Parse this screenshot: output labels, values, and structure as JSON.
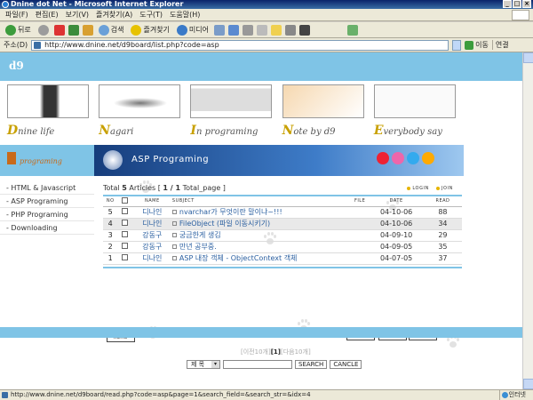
{
  "window": {
    "title": "Dnine dot Net - Microsoft Internet Explorer"
  },
  "menu": [
    "파일(F)",
    "편집(E)",
    "보기(V)",
    "즐겨찾기(A)",
    "도구(T)",
    "도움말(H)"
  ],
  "toolbar": {
    "back": "뒤로",
    "search": "검색",
    "favorites": "즐겨찾기",
    "media": "미디어"
  },
  "address": {
    "label": "주소(D)",
    "url": "http://www.dnine.net/d9board/list.php?code=asp",
    "go": "이동",
    "links": "연결"
  },
  "site": {
    "logo": "d9",
    "nav": [
      {
        "cap": "D",
        "rest": "nine life"
      },
      {
        "cap": "N",
        "rest": "agari"
      },
      {
        "cap": "I",
        "rest": "n programing"
      },
      {
        "cap": "N",
        "rest": "ote by d9"
      },
      {
        "cap": "E",
        "rest": "verybody say"
      }
    ],
    "section_label": "programing",
    "side_menu": [
      "- HTML & Javascript",
      "- ASP Programing",
      "- PHP Programing",
      "- Downloading"
    ]
  },
  "board": {
    "banner_title": "ASP Programing",
    "summary_total_label": "Total",
    "summary_count": "5",
    "summary_articles_label": "Articles [",
    "summary_page": "1 / 1",
    "summary_total_page_label": "Total_page ]",
    "login": "login",
    "join": "join",
    "columns": {
      "no": "no",
      "name": "name",
      "subject": "subject",
      "file": "file",
      "date": "date",
      "read": "read"
    },
    "rows": [
      {
        "no": "5",
        "name": "디나인",
        "subject": "nvarchar가 무엇이란 말이냐~!!!",
        "date": "04-10-06",
        "read": "88"
      },
      {
        "no": "4",
        "name": "디나인",
        "subject": "FileObject (파일 이동시키기)",
        "date": "04-10-06",
        "read": "34"
      },
      {
        "no": "3",
        "name": "강동구",
        "subject": "궁금한게 생김",
        "date": "04-09-10",
        "read": "29"
      },
      {
        "no": "2",
        "name": "강동구",
        "subject": "만년 공부중.",
        "date": "04-09-05",
        "read": "35"
      },
      {
        "no": "1",
        "name": "디나인",
        "subject": "ASP 내장 객체 - ObjectContext 객체",
        "date": "04-07-05",
        "read": "37"
      }
    ],
    "buttons": {
      "read": "read",
      "list": "list",
      "prev": "prev",
      "next": "next"
    },
    "pager": {
      "prev": "[이전10개]",
      "current": "[1]",
      "next": "[다음10개]"
    },
    "search": {
      "field": "제 목",
      "search_btn": "SEARCH",
      "cancel_btn": "CANCLE"
    }
  },
  "status": {
    "url": "http://www.dnine.net/d9board/read.php?code=asp&page=1&search_field=&search_str=&idx=4",
    "zone": "인터넷"
  }
}
